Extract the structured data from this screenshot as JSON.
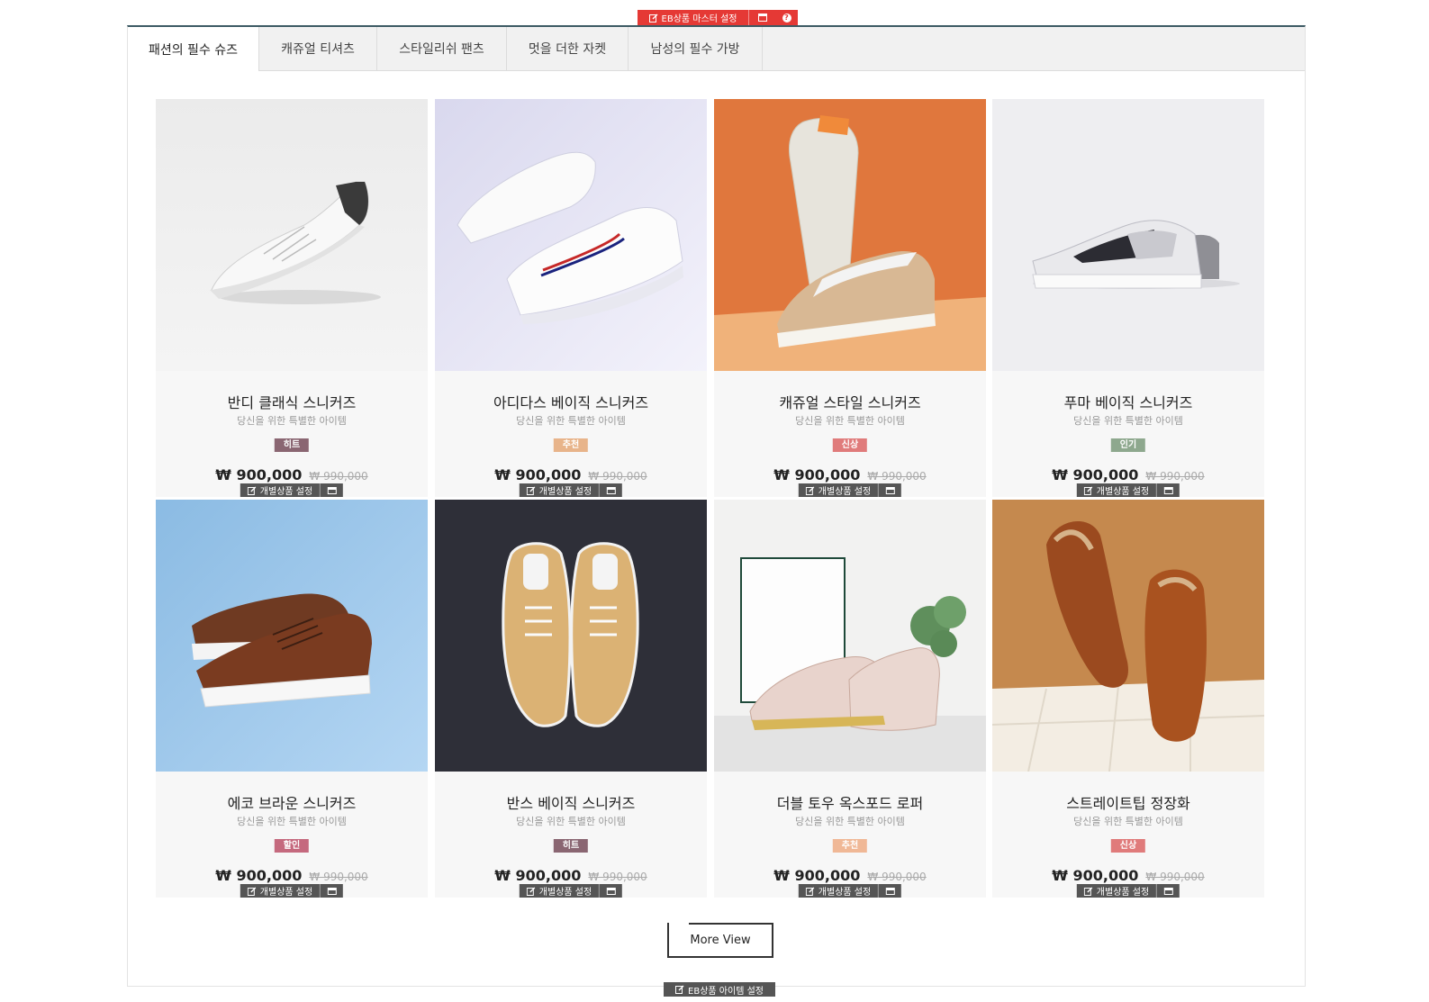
{
  "admin": {
    "master_label": "EB상품 마스터 설정",
    "help_label": "?",
    "item_admin_label": "개별상품 설정",
    "bottom_admin_label": "EB상품 아이템 설정"
  },
  "tabs": [
    {
      "label": "패션의 필수 슈즈",
      "active": true
    },
    {
      "label": "캐쥬얼 티셔츠",
      "active": false
    },
    {
      "label": "스타일리쉬 팬츠",
      "active": false
    },
    {
      "label": "멋을 더한 자켓",
      "active": false
    },
    {
      "label": "남성의 필수 가방",
      "active": false
    }
  ],
  "products": [
    {
      "name": "반디 클래식 스니커즈",
      "desc": "당신을 위한 특별한 아이템",
      "badge": "히트",
      "badge_color": "#8a6672",
      "price": "₩ 900,000",
      "old_price": "₩ 990,000",
      "image": "white-sneaker-icon"
    },
    {
      "name": "아디다스 베이직 스니커즈",
      "desc": "당신을 위한 특별한 아이템",
      "badge": "추천",
      "badge_color": "#e8b48a",
      "price": "₩ 900,000",
      "old_price": "₩ 990,000",
      "image": "adidas-sneakers-icon"
    },
    {
      "name": "캐쥬얼 스타일 스니커즈",
      "desc": "당신을 위한 특별한 아이템",
      "badge": "신상",
      "badge_color": "#e07b7b",
      "price": "₩ 900,000",
      "old_price": "₩ 990,000",
      "image": "casual-sneakers-icon"
    },
    {
      "name": "푸마 베이직 스니커즈",
      "desc": "당신을 위한 특별한 아이템",
      "badge": "인기",
      "badge_color": "#8ea88e",
      "price": "₩ 900,000",
      "old_price": "₩ 990,000",
      "image": "puma-sneakers-icon"
    },
    {
      "name": "에코 브라운 스니커즈",
      "desc": "당신을 위한 특별한 아이템",
      "badge": "할인",
      "badge_color": "#c5697e",
      "price": "₩ 900,000",
      "old_price": "₩ 990,000",
      "image": "brown-sneakers-icon"
    },
    {
      "name": "반스 베이직 스니커즈",
      "desc": "당신을 위한 특별한 아이템",
      "badge": "히트",
      "badge_color": "#8a6672",
      "price": "₩ 900,000",
      "old_price": "₩ 990,000",
      "image": "vans-sneakers-icon"
    },
    {
      "name": "더블 토우 옥스포드 로퍼",
      "desc": "당신을 위한 특별한 아이템",
      "badge": "추천",
      "badge_color": "#f0b896",
      "price": "₩ 900,000",
      "old_price": "₩ 990,000",
      "image": "oxford-loafer-icon"
    },
    {
      "name": "스트레이트팁 정장화",
      "desc": "당신을 위한 특별한 아이템",
      "badge": "신상",
      "badge_color": "#e07b7b",
      "price": "₩ 900,000",
      "old_price": "₩ 990,000",
      "image": "dress-shoes-icon"
    }
  ],
  "more_view_label": "More View",
  "colors": {
    "admin_red": "#e53935",
    "admin_dark": "#555555",
    "tab_bar_accent": "#3d5a64"
  }
}
